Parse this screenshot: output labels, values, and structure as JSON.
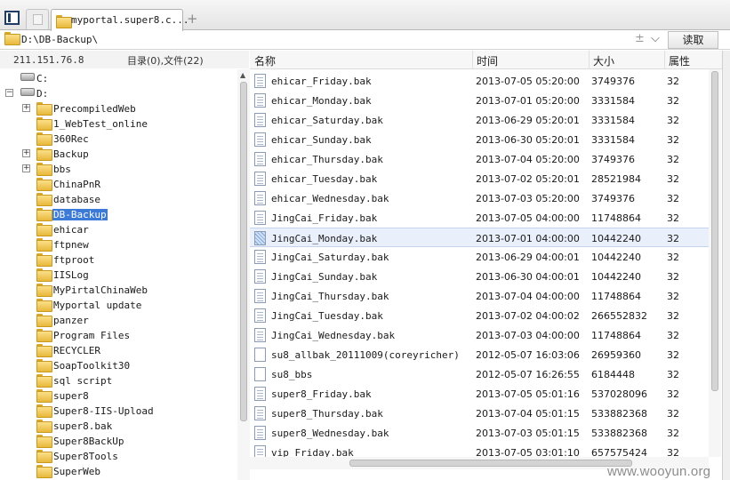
{
  "tab": {
    "title": "myportal.super8.c..."
  },
  "address": {
    "path": "D:\\DB-Backup\\",
    "read_button": "读取",
    "plus_glyph": "±",
    "dropdown_glyph": "⌵"
  },
  "left_header": {
    "ip": "211.151.76.8",
    "counts": "目录(0),文件(22)"
  },
  "tree": {
    "drives": [
      "C:",
      "D:"
    ],
    "folders": [
      {
        "label": "PrecompiledWeb",
        "expander": "+"
      },
      {
        "label": "1_WebTest_online",
        "expander": ""
      },
      {
        "label": "360Rec",
        "expander": ""
      },
      {
        "label": "Backup",
        "expander": "+"
      },
      {
        "label": "bbs",
        "expander": "+"
      },
      {
        "label": "ChinaPnR",
        "expander": ""
      },
      {
        "label": "database",
        "expander": ""
      },
      {
        "label": "DB-Backup",
        "expander": "",
        "selected": true
      },
      {
        "label": "ehicar",
        "expander": ""
      },
      {
        "label": "ftpnew",
        "expander": ""
      },
      {
        "label": "ftproot",
        "expander": ""
      },
      {
        "label": "IISLog",
        "expander": ""
      },
      {
        "label": "MyPirtalChinaWeb",
        "expander": ""
      },
      {
        "label": "Myportal update",
        "expander": ""
      },
      {
        "label": "panzer",
        "expander": ""
      },
      {
        "label": "Program Files",
        "expander": ""
      },
      {
        "label": "RECYCLER",
        "expander": ""
      },
      {
        "label": "SoapToolkit30",
        "expander": ""
      },
      {
        "label": "sql script",
        "expander": ""
      },
      {
        "label": "super8",
        "expander": ""
      },
      {
        "label": "Super8-IIS-Upload",
        "expander": ""
      },
      {
        "label": "super8.bak",
        "expander": ""
      },
      {
        "label": "Super8BackUp",
        "expander": ""
      },
      {
        "label": "Super8Tools",
        "expander": ""
      },
      {
        "label": "SuperWeb",
        "expander": ""
      }
    ]
  },
  "columns": {
    "name": "名称",
    "time": "时间",
    "size": "大小",
    "attr": "属性"
  },
  "files": [
    {
      "name": "ehicar_Friday.bak",
      "time": "2013-07-05 05:20:00",
      "size": "3749376",
      "attr": "32",
      "icon": "doc"
    },
    {
      "name": "ehicar_Monday.bak",
      "time": "2013-07-01 05:20:00",
      "size": "3331584",
      "attr": "32",
      "icon": "doc"
    },
    {
      "name": "ehicar_Saturday.bak",
      "time": "2013-06-29 05:20:01",
      "size": "3331584",
      "attr": "32",
      "icon": "doc"
    },
    {
      "name": "ehicar_Sunday.bak",
      "time": "2013-06-30 05:20:01",
      "size": "3331584",
      "attr": "32",
      "icon": "doc"
    },
    {
      "name": "ehicar_Thursday.bak",
      "time": "2013-07-04 05:20:00",
      "size": "3749376",
      "attr": "32",
      "icon": "doc"
    },
    {
      "name": "ehicar_Tuesday.bak",
      "time": "2013-07-02 05:20:01",
      "size": "28521984",
      "attr": "32",
      "icon": "doc"
    },
    {
      "name": "ehicar_Wednesday.bak",
      "time": "2013-07-03 05:20:00",
      "size": "3749376",
      "attr": "32",
      "icon": "doc"
    },
    {
      "name": "JingCai_Friday.bak",
      "time": "2013-07-05 04:00:00",
      "size": "11748864",
      "attr": "32",
      "icon": "doc"
    },
    {
      "name": "JingCai_Monday.bak",
      "time": "2013-07-01 04:00:00",
      "size": "10442240",
      "attr": "32",
      "icon": "checked",
      "highlighted": true
    },
    {
      "name": "JingCai_Saturday.bak",
      "time": "2013-06-29 04:00:01",
      "size": "10442240",
      "attr": "32",
      "icon": "doc"
    },
    {
      "name": "JingCai_Sunday.bak",
      "time": "2013-06-30 04:00:01",
      "size": "10442240",
      "attr": "32",
      "icon": "doc"
    },
    {
      "name": "JingCai_Thursday.bak",
      "time": "2013-07-04 04:00:00",
      "size": "11748864",
      "attr": "32",
      "icon": "doc"
    },
    {
      "name": "JingCai_Tuesday.bak",
      "time": "2013-07-02 04:00:02",
      "size": "266552832",
      "attr": "32",
      "icon": "doc"
    },
    {
      "name": "JingCai_Wednesday.bak",
      "time": "2013-07-03 04:00:00",
      "size": "11748864",
      "attr": "32",
      "icon": "doc"
    },
    {
      "name": "su8_allbak_20111009(coreyricher)",
      "time": "2012-05-07 16:03:06",
      "size": "26959360",
      "attr": "32",
      "icon": "plain"
    },
    {
      "name": "su8_bbs",
      "time": "2012-05-07 16:26:55",
      "size": "6184448",
      "attr": "32",
      "icon": "plain"
    },
    {
      "name": "super8_Friday.bak",
      "time": "2013-07-05 05:01:16",
      "size": "537028096",
      "attr": "32",
      "icon": "doc"
    },
    {
      "name": "super8_Thursday.bak",
      "time": "2013-07-04 05:01:15",
      "size": "533882368",
      "attr": "32",
      "icon": "doc"
    },
    {
      "name": "super8_Wednesday.bak",
      "time": "2013-07-03 05:01:15",
      "size": "533882368",
      "attr": "32",
      "icon": "doc"
    },
    {
      "name": "vip_Friday.bak",
      "time": "2013-07-05 03:01:10",
      "size": "657575424",
      "attr": "32",
      "icon": "doc"
    }
  ],
  "watermark": "www.wooyun.org"
}
